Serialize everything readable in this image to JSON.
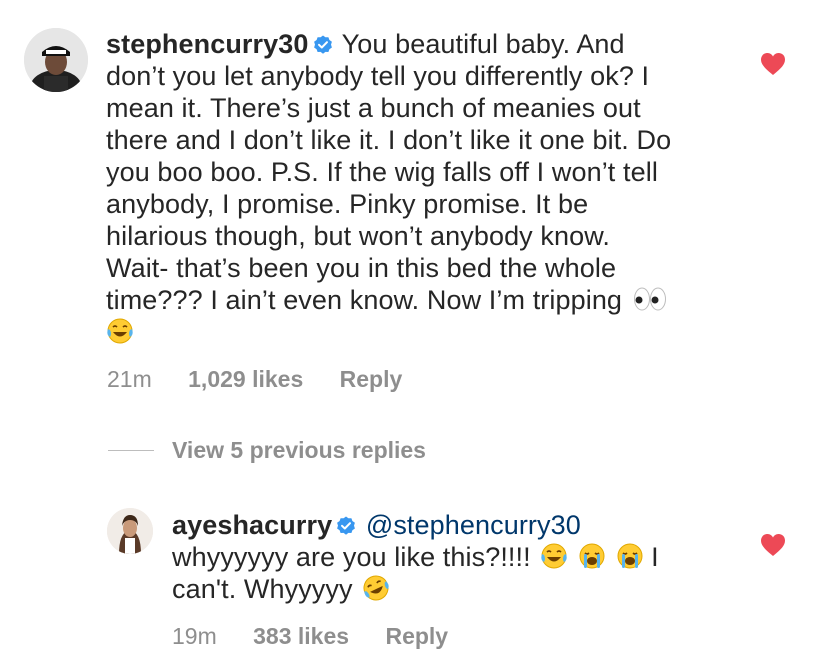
{
  "comment": {
    "username": "stephencurry30",
    "text_lines": [
      "You beautiful baby. And",
      "don’t you let anybody tell you differently ok? I",
      "mean it. There’s just a bunch of meanies out",
      "there and I don’t like it. I don’t like it one bit. Do",
      "you boo boo. P.S. If the wig falls off I won’t tell",
      "anybody, I promise. Pinky promise. It be",
      "hilarious though, but won’t anybody know.",
      "Wait- that’s been you in this bed the whole",
      "time??? I ain’t even know. Now I’m tripping"
    ],
    "time": "21m",
    "likes": "1,029 likes",
    "reply_label": "Reply",
    "heart_color": "#ed4956",
    "verified_color": "#3897f0"
  },
  "view_replies_label": "View 5 previous replies",
  "reply": {
    "username": "ayeshacurry",
    "mention": "@stephencurry30",
    "line1": "whyyyyyy are you like this?!!!!",
    "line1_end": "I",
    "line2": "can't. Whyyyyy",
    "time": "19m",
    "likes": "383 likes",
    "reply_label": "Reply"
  }
}
